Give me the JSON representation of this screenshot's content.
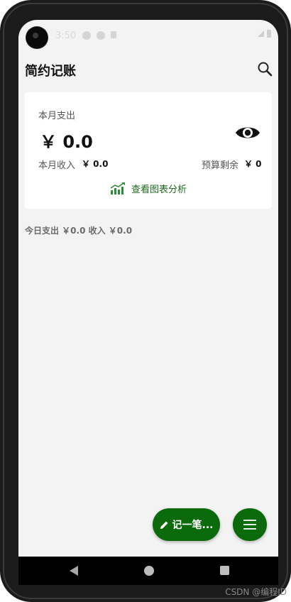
{
  "status_bar": {
    "time": "3:50"
  },
  "header": {
    "title": "简约记账",
    "search_icon": "search-icon"
  },
  "summary_card": {
    "monthly_expense_label": "本月支出",
    "monthly_expense_amount": "￥ 0.0",
    "toggle_visibility_icon": "eye-icon",
    "monthly_income_label": "本月收入",
    "monthly_income_value": "￥ 0.0",
    "budget_remaining_label": "预算剩余",
    "budget_remaining_value": "￥ 0",
    "chart_link_icon": "bar-chart-trend-icon",
    "chart_link_label": "查看图表分析"
  },
  "today_summary": "今日支出 ￥0.0 收入 ￥0.0",
  "fab_record": {
    "icon": "pencil-icon",
    "label": "记一笔..."
  },
  "fab_menu": {
    "icon": "menu-icon"
  },
  "watermark": "CSDN @编程ID",
  "colors": {
    "accent": "#0b6a0b",
    "chart_icon": "#2e8b3e",
    "background": "#f3f3f3",
    "card": "#ffffff"
  }
}
